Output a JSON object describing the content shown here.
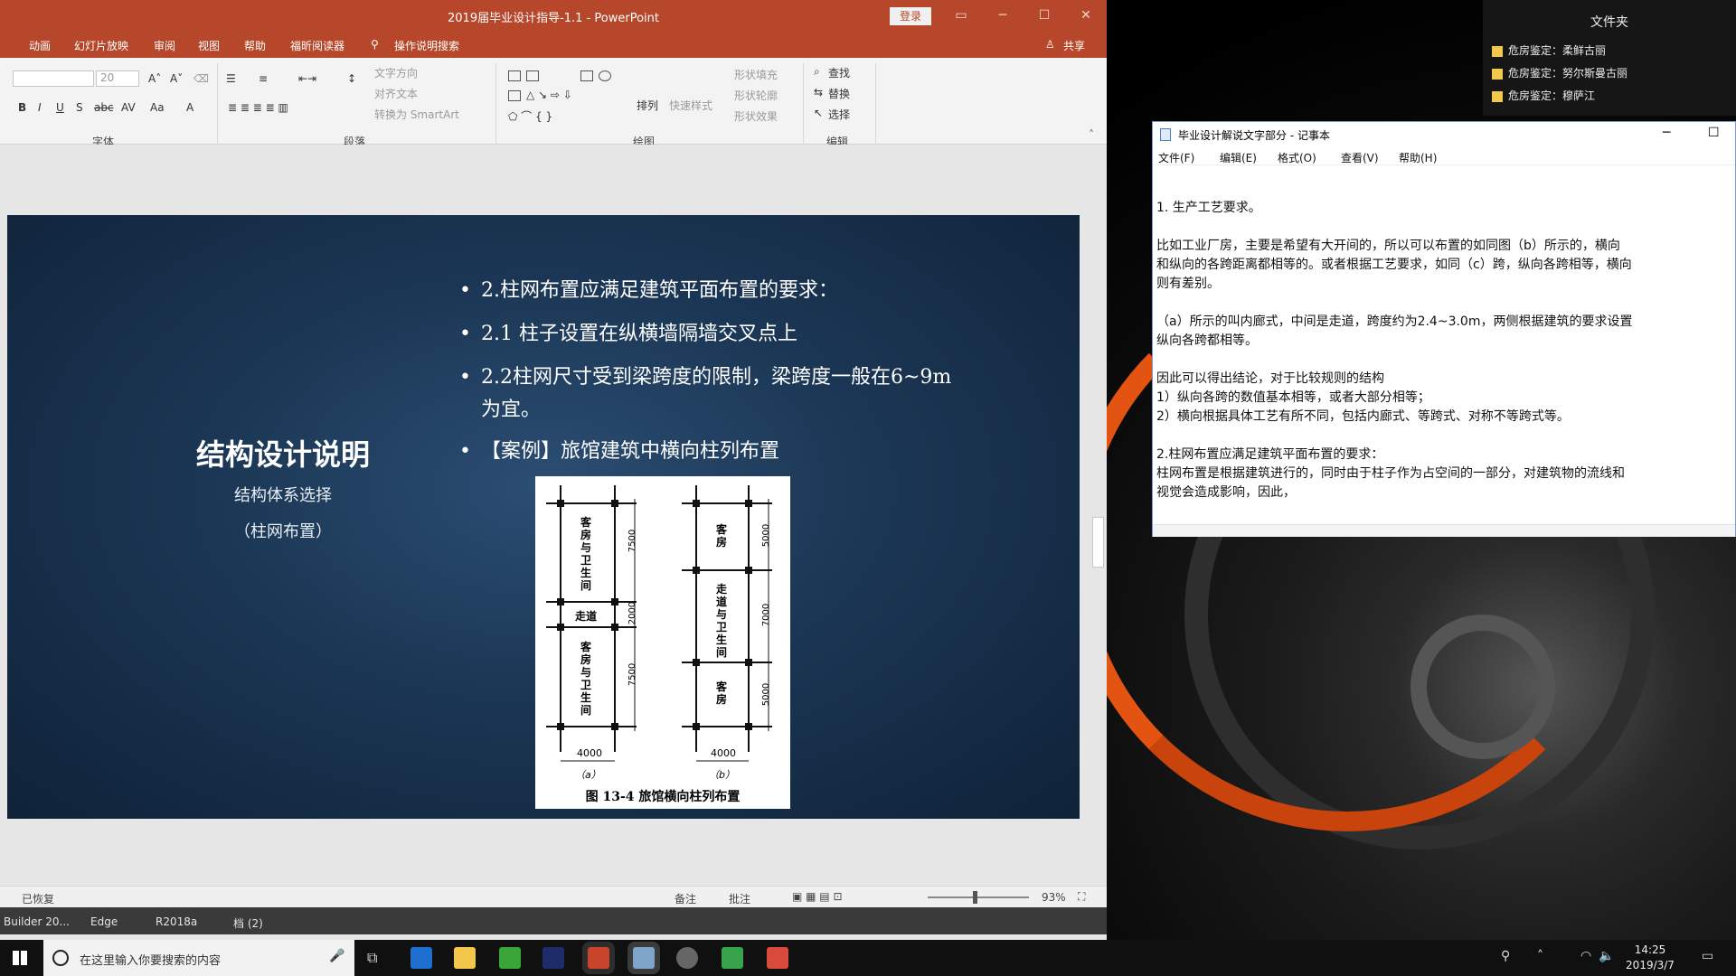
{
  "folder_panel": {
    "title": "文件夹",
    "items": [
      "危房鉴定：柔鲜古丽",
      "危房鉴定：努尔斯曼古丽",
      "危房鉴定：穆萨江"
    ]
  },
  "ppt": {
    "title": "2019届毕业设计指导-1.1  -  PowerPoint",
    "login": "登录",
    "menu": [
      "动画",
      "幻灯片放映",
      "审阅",
      "视图",
      "帮助",
      "福昕阅读器",
      "操作说明搜索",
      "共享"
    ],
    "ribbon": {
      "font_size": "20",
      "groups": [
        "字体",
        "段落",
        "绘图",
        "编辑"
      ],
      "para_tools": [
        "文字方向",
        "对齐文本",
        "转换为 SmartArt"
      ],
      "draw_tools": [
        "排列",
        "快速样式",
        "形状填充",
        "形状轮廓",
        "形状效果"
      ],
      "edit_tools": [
        "查找",
        "替换",
        "选择"
      ]
    },
    "slide": {
      "title": "结构设计说明",
      "subtitle": "结构体系选择",
      "subtitle2": "（柱网布置）",
      "bullets": [
        "2.柱网布置应满足建筑平面布置的要求：",
        "2.1 柱子设置在纵横墙隔墙交叉点上",
        "2.2柱网尺寸受到梁跨度的限制，梁跨度一般在6~9m为宜。",
        "【案例】旅馆建筑中横向柱列布置"
      ],
      "figure": {
        "caption": "图 13-4   旅馆横向柱列布置",
        "a_label": "（a）",
        "b_label": "（b）",
        "a_rooms": [
          "客房与卫生间",
          "走道",
          "客房与卫生间"
        ],
        "b_rooms": [
          "客房",
          "走道与卫生间",
          "客房"
        ],
        "a_dims": [
          "7500",
          "2000",
          "7500"
        ],
        "b_dims": [
          "5000",
          "7000",
          "5000"
        ],
        "width": "4000"
      }
    },
    "status": {
      "left": "已恢复",
      "notes": "备注",
      "comments": "批注",
      "zoom": "93%"
    },
    "taskbar_row": [
      "Builder 20...",
      "Edge",
      "R2018a",
      "档 (2)"
    ]
  },
  "notepad": {
    "title": "毕业设计解说文字部分 - 记事本",
    "menu": [
      "文件(F)",
      "编辑(E)",
      "格式(O)",
      "查看(V)",
      "帮助(H)"
    ],
    "lines": [
      "1. 生产工艺要求。",
      "",
      "比如工业厂房，主要是希望有大开间的，所以可以布置的如同图（b）所示的，横向",
      "和纵向的各跨距离都相等的。或者根据工艺要求，如同（c）跨，纵向各跨相等，横向",
      "则有差别。",
      "",
      "（a）所示的叫内廊式，中间是走道，跨度约为2.4~3.0m，两侧根据建筑的要求设置",
      "纵向各跨都相等。",
      "",
      "因此可以得出结论，对于比较规则的结构",
      "1）纵向各跨的数值基本相等，或者大部分相等；",
      "2）横向根据具体工艺有所不同，包括内廊式、等跨式、对称不等跨式等。",
      "",
      "2.柱网布置应满足建筑平面布置的要求：",
      "柱网布置是根据建筑进行的，同时由于柱子作为占空间的一部分，对建筑物的流线和",
      "视觉会造成影响，因此，"
    ]
  },
  "taskbar": {
    "search_placeholder": "在这里输入你要搜索的内容",
    "time": "14:25",
    "date": "2019/3/7"
  },
  "colors": {
    "ppt_accent": "#b7472a",
    "slide_bg": "#1b3654",
    "desktop_orange": "#e35412"
  }
}
